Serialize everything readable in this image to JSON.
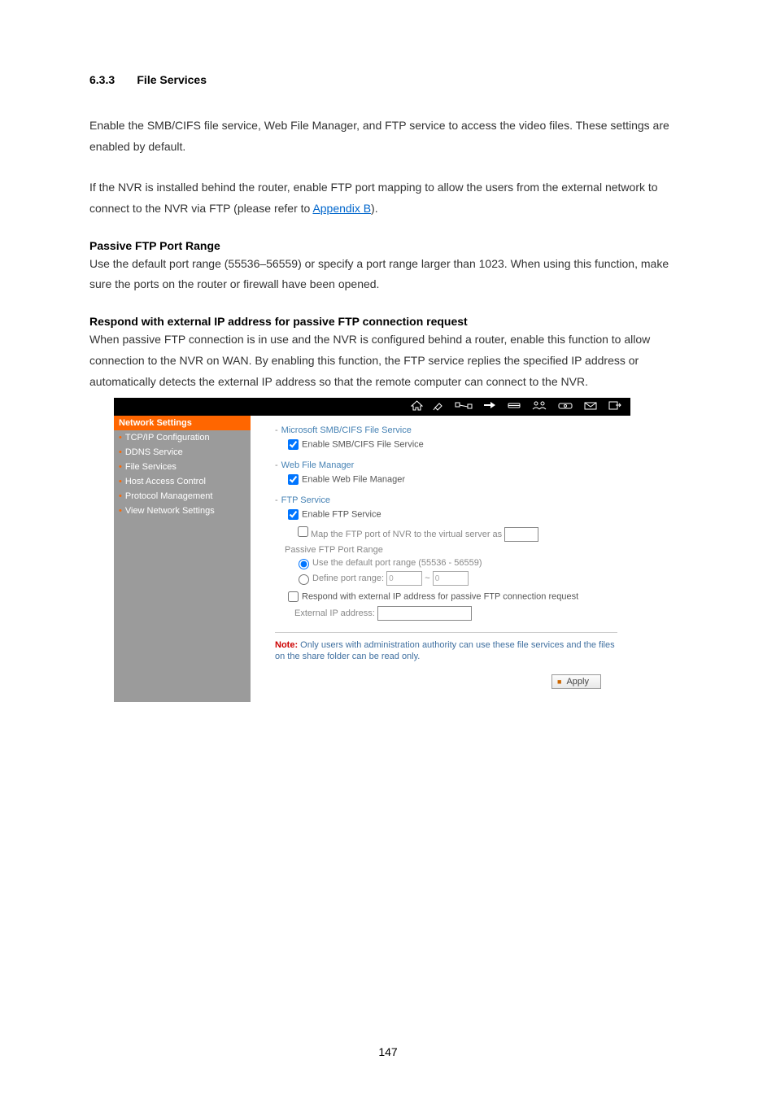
{
  "section_number": "6.3.3",
  "section_title": "File Services",
  "paragraphs": {
    "p1": "Enable the SMB/CIFS file service, Web File Manager, and FTP service to access the video files.   These settings are enabled by default.",
    "p2a": "If the NVR is installed behind the router, enable FTP port mapping to allow the users from the external network to connect to the NVR via FTP (please refer to ",
    "p2_link": "Appendix B",
    "p2b": ")."
  },
  "passive_heading": "Passive FTP Port Range",
  "passive_para": "Use the default port range (55536–56559) or specify a port range larger than 1023.    When using this function, make sure the ports on the router or firewall have been opened.",
  "respond_heading": "Respond with external IP address for passive FTP connection request",
  "respond_para": "When passive FTP connection is in use and the NVR is configured behind a router, enable this function to allow connection to the NVR on WAN.   By enabling this function, the FTP service replies the specified IP address or automatically detects the external IP address so that the remote computer can connect to the NVR.",
  "screenshot": {
    "sidebar_header": "Network Settings",
    "sidebar_items": [
      "TCP/IP Configuration",
      "DDNS Service",
      "File Services",
      "Host Access Control",
      "Protocol Management",
      "View Network Settings"
    ],
    "smb": {
      "heading": "Microsoft SMB/CIFS File Service",
      "checkbox": "Enable SMB/CIFS File Service"
    },
    "wfm": {
      "heading": "Web File Manager",
      "checkbox": "Enable Web File Manager"
    },
    "ftp": {
      "heading": "FTP Service",
      "enable": "Enable FTP Service",
      "map_port": "Map the FTP port of NVR to the virtual server as",
      "passive_label": "Passive FTP Port Range",
      "use_default": "Use the default port range (55536 - 56559)",
      "define_range": "Define port range:",
      "range_from": "0",
      "range_sep": "~",
      "range_to": "0",
      "respond_external": "Respond with external IP address for passive FTP connection request",
      "external_ip_label": "External IP address:"
    },
    "note_label": "Note:",
    "note_text": " Only users with administration authority can use these file services and the files on the share folder can be read only.",
    "apply": "Apply"
  },
  "page_number": "147"
}
